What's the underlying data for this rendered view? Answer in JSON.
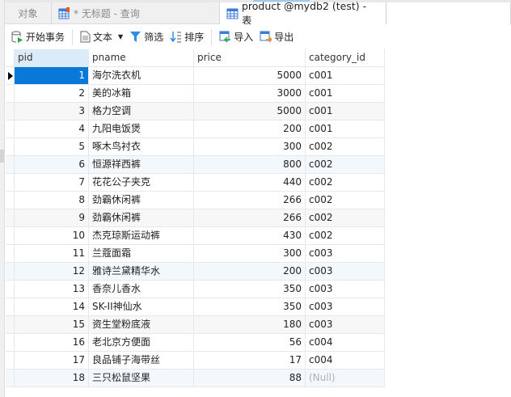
{
  "tabs": [
    {
      "label": "对象"
    },
    {
      "label": "* 无标题 - 查询"
    },
    {
      "label": "product @mydb2 (test) - 表"
    }
  ],
  "toolbar": {
    "begin_tx": "开始事务",
    "text": "文本",
    "filter": "筛选",
    "sort": "排序",
    "import": "导入",
    "export": "导出"
  },
  "table": {
    "columns": [
      "pid",
      "pname",
      "price",
      "category_id"
    ],
    "rows": [
      [
        "1",
        "海尔洗衣机",
        "5000",
        "c001"
      ],
      [
        "2",
        "美的冰箱",
        "3000",
        "c001"
      ],
      [
        "3",
        "格力空调",
        "5000",
        "c001"
      ],
      [
        "4",
        "九阳电饭煲",
        "200",
        "c001"
      ],
      [
        "5",
        "啄木鸟衬衣",
        "300",
        "c002"
      ],
      [
        "6",
        "恒源祥西裤",
        "800",
        "c002"
      ],
      [
        "7",
        "花花公子夹克",
        "440",
        "c002"
      ],
      [
        "8",
        "劲霸休闲裤",
        "266",
        "c002"
      ],
      [
        "9",
        "劲霸休闲裤",
        "266",
        "c002"
      ],
      [
        "10",
        "杰克琼斯运动裤",
        "430",
        "c002"
      ],
      [
        "11",
        "兰蔻面霜",
        "300",
        "c003"
      ],
      [
        "12",
        "雅诗兰黛精华水",
        "200",
        "c003"
      ],
      [
        "13",
        "香奈儿香水",
        "350",
        "c003"
      ],
      [
        "14",
        "SK-II神仙水",
        "350",
        "c003"
      ],
      [
        "15",
        "资生堂粉底液",
        "180",
        "c003"
      ],
      [
        "16",
        "老北京方便面",
        "56",
        "c004"
      ],
      [
        "17",
        "良品铺子海带丝",
        "17",
        "c004"
      ],
      [
        "18",
        "三只松鼠坚果",
        "88",
        "(Null)"
      ]
    ]
  }
}
